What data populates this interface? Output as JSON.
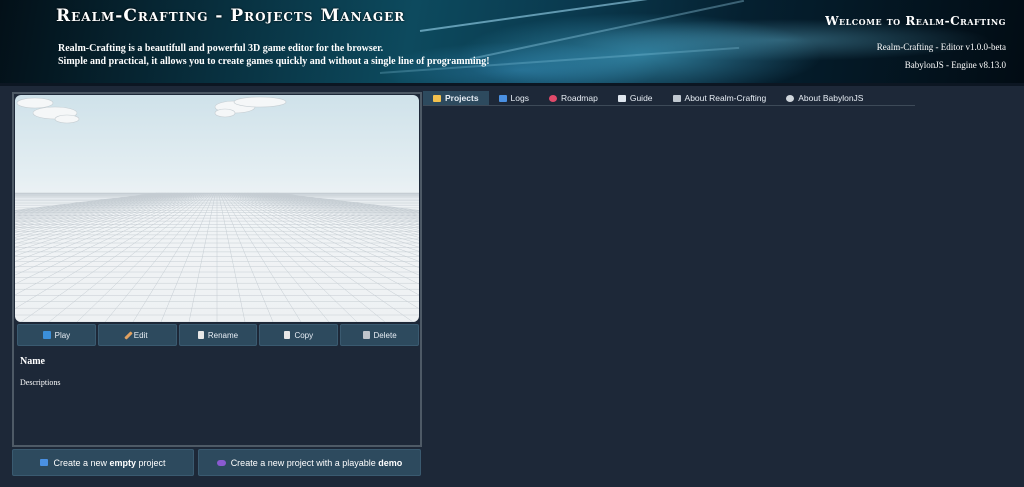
{
  "header": {
    "title": "Realm-Crafting - Projects Manager",
    "tagline_line1": "Realm-Crafting is a beautifull and powerful 3D game editor for the browser.",
    "tagline_line2": "Simple and practical, it allows you to create games quickly and without a single line of programming!",
    "welcome": "Welcome to Realm-Crafting",
    "editor_version": "Realm-Crafting - Editor v1.0.0-beta",
    "engine_version": "BabylonJS - Engine v8.13.0"
  },
  "project": {
    "actions": [
      {
        "label": "Play",
        "icon": "play-icon",
        "color": "#3b8fd9"
      },
      {
        "label": "Edit",
        "icon": "pencil-icon",
        "color": "#e0a060"
      },
      {
        "label": "Rename",
        "icon": "document-icon",
        "color": "#e8e8e8"
      },
      {
        "label": "Copy",
        "icon": "copy-icon",
        "color": "#e8e8e8"
      },
      {
        "label": "Delete",
        "icon": "trash-icon",
        "color": "#bfc5cc"
      }
    ],
    "name": "Name",
    "description": "Descriptions"
  },
  "create": {
    "empty_prefix": "Create a new ",
    "empty_bold": "empty",
    "empty_suffix": " project",
    "demo_prefix": "Create a new project with a playable ",
    "demo_bold": "demo"
  },
  "tabs": [
    {
      "label": "Projects",
      "icon": "folder-icon",
      "color": "#f2c14e",
      "active": true
    },
    {
      "label": "Logs",
      "icon": "log-icon",
      "color": "#4a90e2",
      "active": false
    },
    {
      "label": "Roadmap",
      "icon": "pin-icon",
      "color": "#e04a6a",
      "active": false
    },
    {
      "label": "Guide",
      "icon": "book-icon",
      "color": "#dfe6ee",
      "active": false
    },
    {
      "label": "About Realm-Crafting",
      "icon": "tools-icon",
      "color": "#c0c8d0",
      "active": false
    },
    {
      "label": "About BabylonJS",
      "icon": "gear-icon",
      "color": "#d0d6dc",
      "active": false
    }
  ]
}
